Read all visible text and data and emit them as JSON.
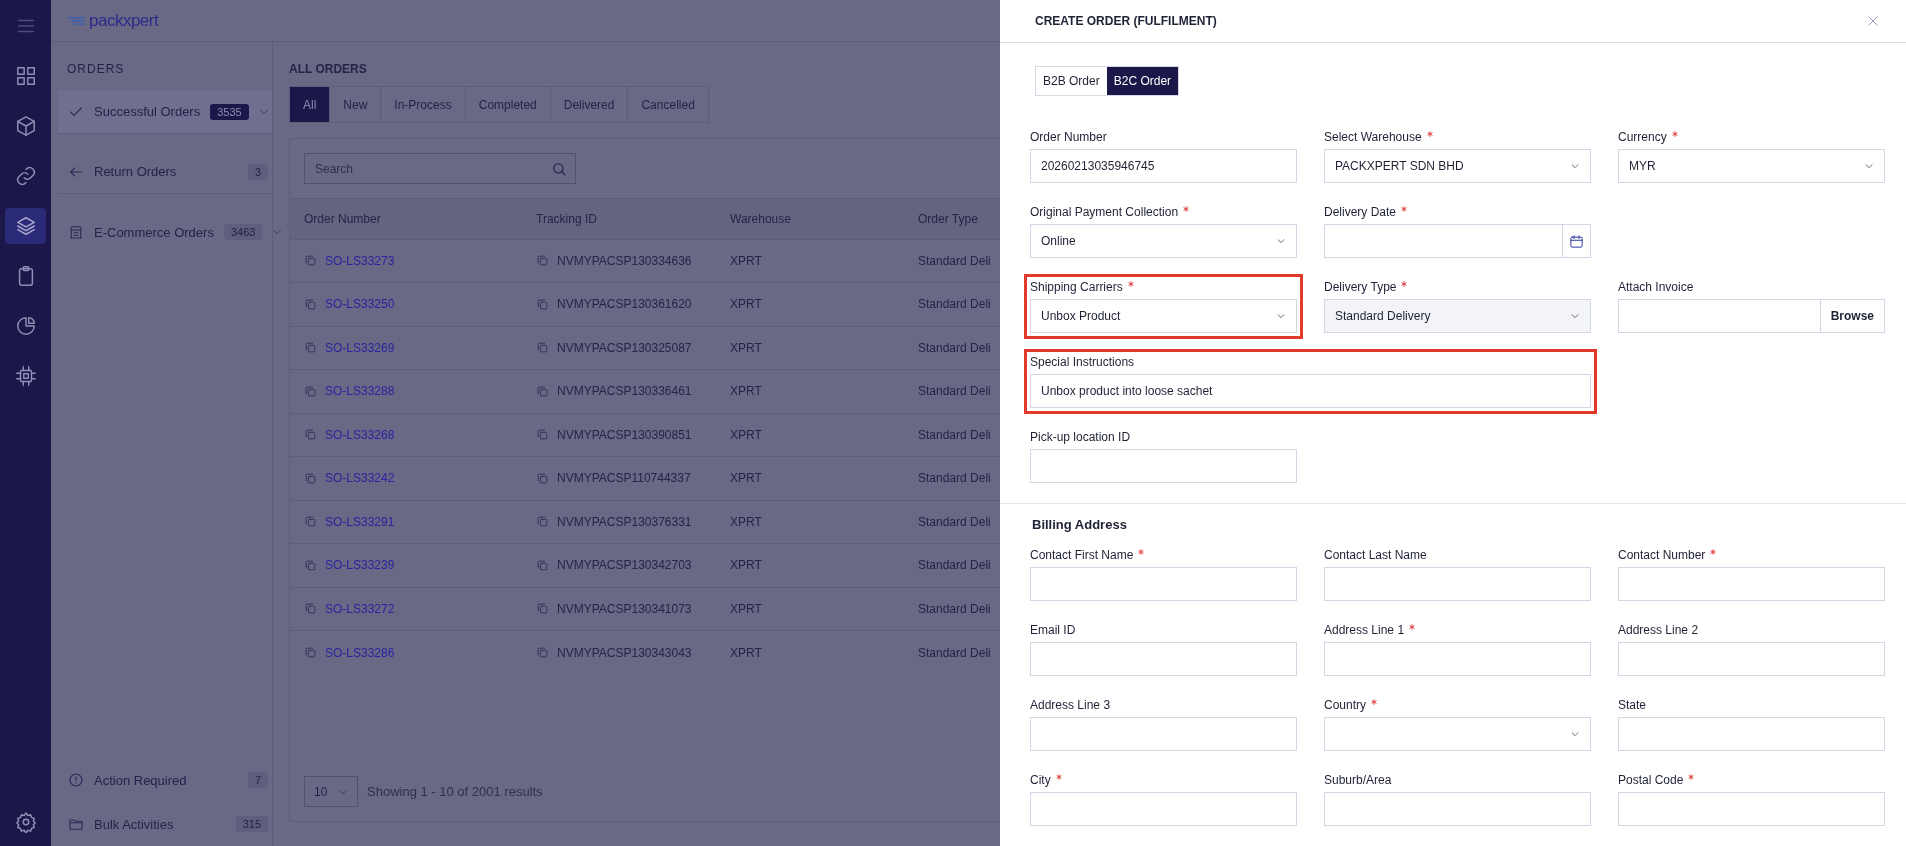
{
  "rail": {
    "items": [
      {
        "selected": false
      },
      {
        "selected": false
      },
      {
        "selected": false
      },
      {
        "selected": true
      },
      {
        "selected": false
      },
      {
        "selected": false
      },
      {
        "selected": false
      }
    ]
  },
  "logo": "packxpert",
  "sidebar": {
    "title": "ORDERS",
    "items": [
      {
        "label": "Successful Orders",
        "count": "3535",
        "selected": true,
        "chevron": true
      },
      {
        "label": "Return Orders",
        "count": "3",
        "selected": false,
        "chevron": false
      },
      {
        "label": "E-Commerce Orders",
        "count": "3463",
        "selected": false,
        "chevron": true
      }
    ],
    "bottom_items": [
      {
        "label": "Action Required",
        "count": "7"
      },
      {
        "label": "Bulk Activities",
        "count": "315"
      }
    ]
  },
  "main": {
    "title": "ALL ORDERS",
    "tabs": [
      {
        "label": "All",
        "selected": true
      },
      {
        "label": "New",
        "selected": false
      },
      {
        "label": "In-Process",
        "selected": false
      },
      {
        "label": "Completed",
        "selected": false
      },
      {
        "label": "Delivered",
        "selected": false
      },
      {
        "label": "Cancelled",
        "selected": false
      }
    ],
    "search": {
      "placeholder": "Search"
    },
    "table": {
      "columns": [
        "Order Number",
        "Tracking ID",
        "Warehouse",
        "Order Type"
      ],
      "rows": [
        {
          "order": "SO-LS33273",
          "tracking": "NVMYPACSP130334636",
          "warehouse": "XPRT",
          "order_type": "Standard Deli"
        },
        {
          "order": "SO-LS33250",
          "tracking": "NVMYPACSP130361620",
          "warehouse": "XPRT",
          "order_type": "Standard Deli"
        },
        {
          "order": "SO-LS33269",
          "tracking": "NVMYPACSP130325087",
          "warehouse": "XPRT",
          "order_type": "Standard Deli"
        },
        {
          "order": "SO-LS33288",
          "tracking": "NVMYPACSP130336461",
          "warehouse": "XPRT",
          "order_type": "Standard Deli"
        },
        {
          "order": "SO-LS33268",
          "tracking": "NVMYPACSP130390851",
          "warehouse": "XPRT",
          "order_type": "Standard Deli"
        },
        {
          "order": "SO-LS33242",
          "tracking": "NVMYPACSP110744337",
          "warehouse": "XPRT",
          "order_type": "Standard Deli"
        },
        {
          "order": "SO-LS33291",
          "tracking": "NVMYPACSP130376331",
          "warehouse": "XPRT",
          "order_type": "Standard Deli"
        },
        {
          "order": "SO-LS33239",
          "tracking": "NVMYPACSP130342703",
          "warehouse": "XPRT",
          "order_type": "Standard Deli"
        },
        {
          "order": "SO-LS33272",
          "tracking": "NVMYPACSP130341073",
          "warehouse": "XPRT",
          "order_type": "Standard Deli"
        },
        {
          "order": "SO-LS33286",
          "tracking": "NVMYPACSP130343043",
          "warehouse": "XPRT",
          "order_type": "Standard Deli"
        }
      ]
    },
    "pagination": {
      "page_size": "10",
      "summary": "Showing 1 - 10 of 2001 results"
    }
  },
  "drawer": {
    "title": "CREATE ORDER (FULFILMENT)",
    "order_types": [
      {
        "label": "B2B Order",
        "selected": false
      },
      {
        "label": "B2C Order",
        "selected": true
      }
    ],
    "fields": [
      {
        "kind": "text",
        "label": "Order Number",
        "required": false,
        "value": "20260213035946745",
        "highlighted": false
      },
      {
        "kind": "select",
        "label": "Select Warehouse",
        "required": true,
        "value": "PACKXPERT SDN BHD",
        "highlighted": false
      },
      {
        "kind": "select",
        "label": "Currency",
        "required": true,
        "value": "MYR",
        "highlighted": false
      },
      {
        "kind": "select",
        "label": "Original Payment Collection",
        "required": true,
        "value": "Online",
        "highlighted": false
      },
      {
        "kind": "date",
        "label": "Delivery Date",
        "required": true,
        "highlighted": false
      },
      {
        "kind": "empty"
      },
      {
        "kind": "select",
        "label": "Shipping Carriers",
        "required": true,
        "value": "Unbox Product",
        "highlighted": true
      },
      {
        "kind": "select",
        "label": "Delivery Type",
        "required": true,
        "value": "Standard Delivery",
        "highlighted": false,
        "disabled": true
      },
      {
        "kind": "file",
        "label": "Attach Invoice",
        "required": false,
        "button": "Browse",
        "highlighted": false
      },
      {
        "kind": "long_text",
        "label": "Special Instructions",
        "required": false,
        "value": "Unbox product into loose sachet",
        "highlighted": true
      },
      {
        "kind": "empty"
      },
      {
        "kind": "text",
        "label": "Pick-up location ID",
        "required": false,
        "highlighted": false
      }
    ],
    "billing": {
      "title": "Billing Address",
      "fields": [
        {
          "kind": "text",
          "label": "Contact First Name",
          "required": true
        },
        {
          "kind": "text",
          "label": "Contact Last Name",
          "required": false
        },
        {
          "kind": "text",
          "label": "Contact Number",
          "required": true
        },
        {
          "kind": "text",
          "label": "Email ID",
          "required": false
        },
        {
          "kind": "text",
          "label": "Address Line 1",
          "required": true
        },
        {
          "kind": "text",
          "label": "Address Line 2",
          "required": false
        },
        {
          "kind": "text",
          "label": "Address Line 3",
          "required": false
        },
        {
          "kind": "select",
          "label": "Country",
          "required": true
        },
        {
          "kind": "text",
          "label": "State",
          "required": false
        },
        {
          "kind": "text",
          "label": "City",
          "required": true
        },
        {
          "kind": "text",
          "label": "Suburb/Area",
          "required": false
        },
        {
          "kind": "text",
          "label": "Postal Code",
          "required": true
        }
      ]
    }
  }
}
